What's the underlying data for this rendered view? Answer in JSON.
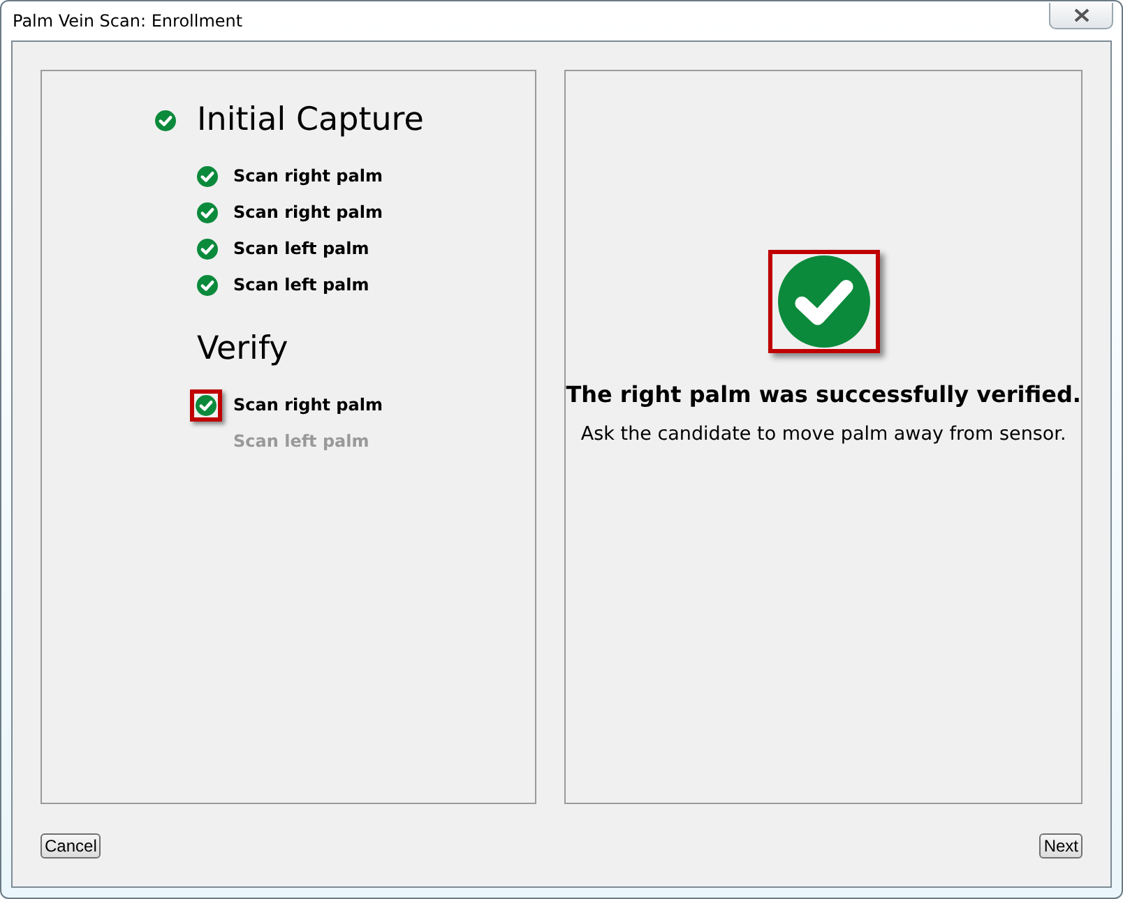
{
  "window": {
    "title": "Palm Vein Scan: Enrollment"
  },
  "sections": [
    {
      "title": "Initial Capture",
      "done": true,
      "steps": [
        {
          "label": "Scan right palm",
          "done": true,
          "highlighted": false
        },
        {
          "label": "Scan right palm",
          "done": true,
          "highlighted": false
        },
        {
          "label": "Scan left palm",
          "done": true,
          "highlighted": false
        },
        {
          "label": "Scan left palm",
          "done": true,
          "highlighted": false
        }
      ]
    },
    {
      "title": "Verify",
      "done": false,
      "steps": [
        {
          "label": "Scan right palm",
          "done": true,
          "highlighted": true
        },
        {
          "label": "Scan left palm",
          "done": false,
          "highlighted": false
        }
      ]
    }
  ],
  "result": {
    "done": true,
    "highlighted": true,
    "title": "The right palm was successfully verified.",
    "message": "Ask the candidate to move palm away from sensor."
  },
  "buttons": [
    {
      "label": "Cancel"
    },
    {
      "label": "Next"
    }
  ]
}
